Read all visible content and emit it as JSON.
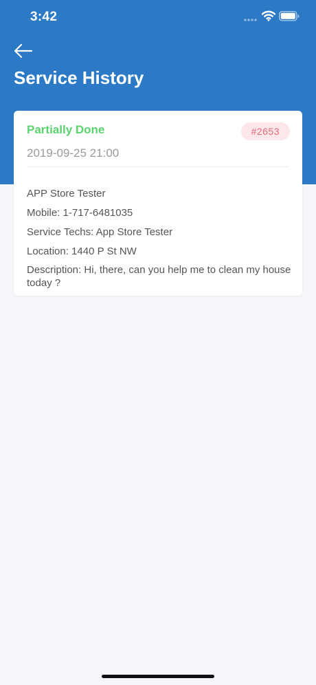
{
  "status_bar": {
    "time": "3:42"
  },
  "header": {
    "title": "Service History",
    "background_color": "#2c7ac6",
    "back_icon": "arrow-left-icon"
  },
  "service_card": {
    "status": "Partially Done",
    "status_color": "#5ad36e",
    "order_number": "#2653",
    "datetime": "2019-09-25 21:00",
    "customer_name": "APP Store Tester",
    "mobile": "Mobile: 1-717-6481035",
    "service_techs": "Service Techs: App Store  Tester",
    "location": "Location: 1440 P St NW",
    "description": "Description: Hi, there, can you help me to clean my house today ?"
  }
}
